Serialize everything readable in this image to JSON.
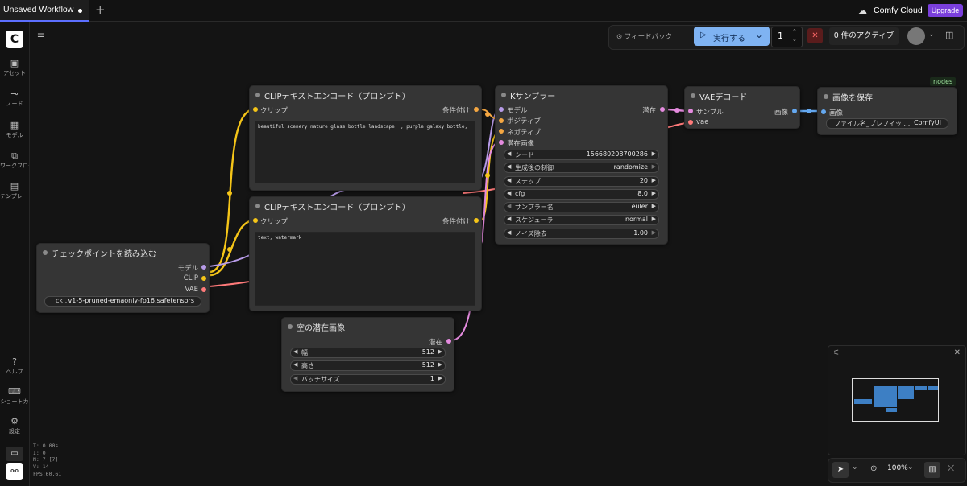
{
  "tabs": {
    "title": "Unsaved Workflow"
  },
  "header": {
    "cloud_label": "Comfy Cloud",
    "upgrade_label": "Upgrade"
  },
  "sidebar": {
    "items": [
      {
        "label": "アセット",
        "icon": "image-icon"
      },
      {
        "label": "ノード",
        "icon": "node-icon"
      },
      {
        "label": "モデル",
        "icon": "model-icon"
      },
      {
        "label": "ワークフロー",
        "icon": "workflow-icon"
      },
      {
        "label": "テンプレート",
        "icon": "template-icon"
      }
    ],
    "bottom_items": [
      {
        "label": "ヘルプ",
        "icon": "help-icon"
      },
      {
        "label": "ショートカ",
        "icon": "keyboard-icon"
      },
      {
        "label": "設定",
        "icon": "gear-icon"
      }
    ]
  },
  "stats": {
    "t": "T: 0.00s",
    "i": "I: 0",
    "n": "N: 7 [7]",
    "v": "V: 14",
    "fps": "FPS:60.61"
  },
  "toolbar": {
    "feedback": "フィードバック",
    "run": "実行する",
    "count": "1",
    "active": "0 件のアクティブ"
  },
  "nodes_badge": "nodes",
  "nodes": {
    "clip1": {
      "title": "CLIPテキストエンコード（プロンプト）",
      "input": "クリップ",
      "output": "条件付け",
      "text": "beautiful scenery nature glass bottle landscape, , purple galaxy bottle,"
    },
    "clip2": {
      "title": "CLIPテキストエンコード（プロンプト）",
      "input": "クリップ",
      "output": "条件付け",
      "text": "text, watermark"
    },
    "checkpoint": {
      "title": "チェックポイントを読み込む",
      "out_model": "モデル",
      "out_clip": "CLIP",
      "out_vae": "VAE",
      "ckpt_label": "ck …",
      "ckpt_value": "v1-5-pruned-emaonly-fp16.safetensors"
    },
    "latent": {
      "title": "空の潜在画像",
      "output": "潜在",
      "widgets": [
        {
          "label": "幅",
          "value": "512"
        },
        {
          "label": "高さ",
          "value": "512"
        },
        {
          "label": "バッチサイズ",
          "value": "1"
        }
      ]
    },
    "ksampler": {
      "title": "Kサンプラー",
      "inputs": [
        "モデル",
        "ポジティブ",
        "ネガティブ",
        "潜在画像"
      ],
      "output": "潜在",
      "widgets": [
        {
          "label": "シード",
          "value": "156680208700286"
        },
        {
          "label": "生成後の制御",
          "value": "randomize"
        },
        {
          "label": "ステップ",
          "value": "20"
        },
        {
          "label": "cfg",
          "value": "8.0"
        },
        {
          "label": "サンプラー名",
          "value": "euler"
        },
        {
          "label": "スケジューラ",
          "value": "normal"
        },
        {
          "label": "ノイズ除去",
          "value": "1.00"
        }
      ]
    },
    "vae": {
      "title": "VAEデコード",
      "in_samples": "サンプル",
      "in_vae": "vae",
      "output": "画像"
    },
    "save": {
      "title": "画像を保存",
      "input": "画像",
      "prefix_label": "ファイル名_プレフィッ …",
      "prefix_value": "ComfyUI"
    }
  },
  "bottom": {
    "zoom": "100%"
  }
}
